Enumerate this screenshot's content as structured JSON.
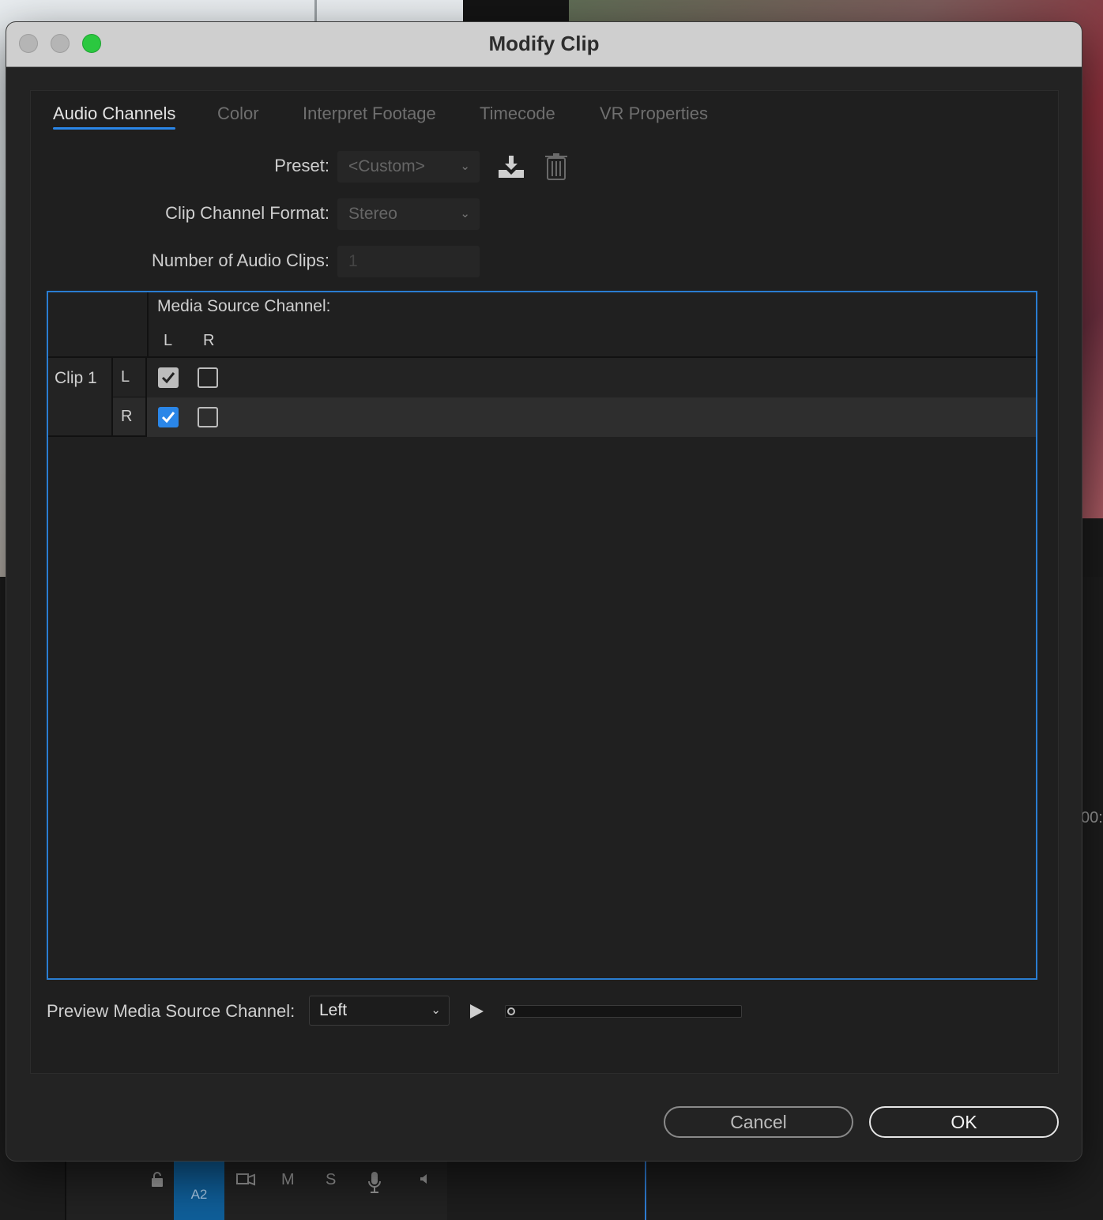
{
  "window": {
    "title": "Modify Clip"
  },
  "tabs": [
    {
      "label": "Audio Channels",
      "active": true
    },
    {
      "label": "Color",
      "active": false
    },
    {
      "label": "Interpret Footage",
      "active": false
    },
    {
      "label": "Timecode",
      "active": false
    },
    {
      "label": "VR Properties",
      "active": false
    }
  ],
  "form": {
    "preset_label": "Preset:",
    "preset_value": "<Custom>",
    "channel_format_label": "Clip Channel Format:",
    "channel_format_value": "Stereo",
    "num_clips_label": "Number of Audio Clips:",
    "num_clips_value": "1",
    "save_preset_icon": "download-icon",
    "delete_preset_icon": "trash-icon"
  },
  "channel_table": {
    "header": "Media Source Channel:",
    "source_columns": [
      "L",
      "R"
    ],
    "clip_label": "Clip 1",
    "rows": [
      {
        "channel": "L",
        "checked": [
          true,
          false
        ],
        "check_color": "#bdbdbd"
      },
      {
        "channel": "R",
        "checked": [
          true,
          false
        ],
        "check_color": "#2a86e8"
      }
    ]
  },
  "preview": {
    "label": "Preview Media Source Channel:",
    "selected": "Left",
    "play_icon": "play-icon",
    "position": 0
  },
  "buttons": {
    "cancel": "Cancel",
    "ok": "OK"
  },
  "background": {
    "track_label": "A2",
    "track_icons": [
      "lock-icon",
      "sync-icon",
      "M",
      "S",
      "microphone-icon",
      "speaker-icon"
    ],
    "timecode_fragment": "00:"
  },
  "colors": {
    "accent": "#2a86e8",
    "zoom_button": "#2bc840",
    "dialog_bg": "#232323",
    "titlebar_bg": "#cfcfcf"
  }
}
